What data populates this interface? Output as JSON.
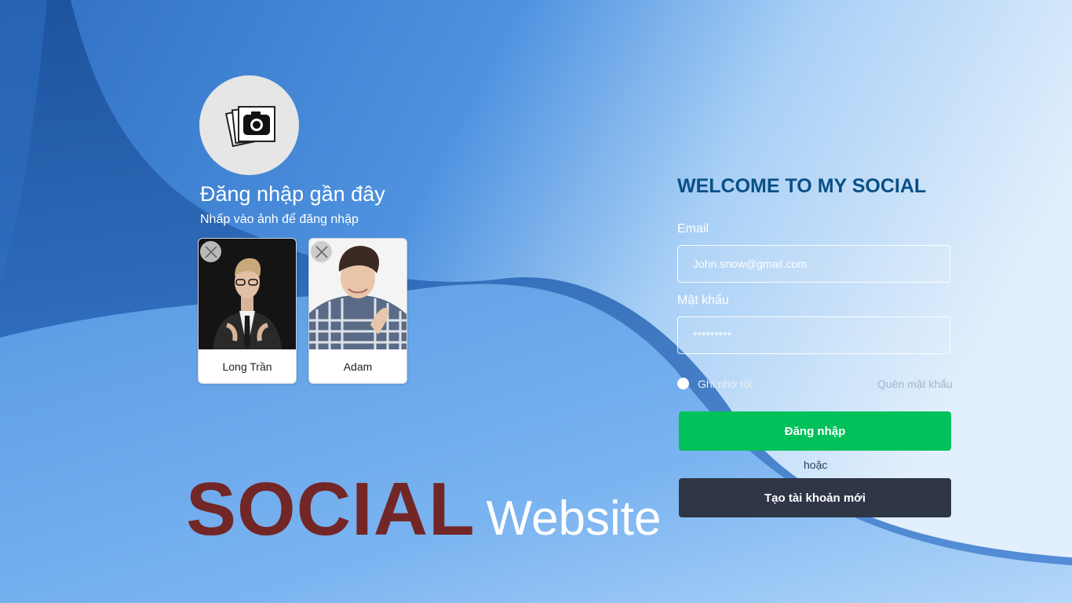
{
  "recent": {
    "title": "Đăng nhập gần đây",
    "subtitle": "Nhấp vào ảnh để đăng nhập",
    "accounts": [
      {
        "name": "Long Trần"
      },
      {
        "name": "Adam"
      }
    ]
  },
  "brand": {
    "primary": "SOCIAL",
    "secondary": "Website",
    "primary_color": "#732626"
  },
  "login": {
    "welcome": "WELCOME TO MY SOCIAL",
    "email_label": "Email",
    "email_placeholder": "John.snow@gmail.com",
    "password_label": "Mật khẩu",
    "password_placeholder": "*********",
    "remember_label": "Ghi nhớ tôi",
    "forgot_label": "Quên mật khẩu",
    "login_button": "Đăng nhập",
    "or_text": "hoặc",
    "create_button": "Tạo tài khoản mới",
    "login_color": "#00c15a",
    "create_color": "#2f3747"
  },
  "icons": {
    "logo": "camera-logo-icon",
    "remove": "close-icon"
  }
}
